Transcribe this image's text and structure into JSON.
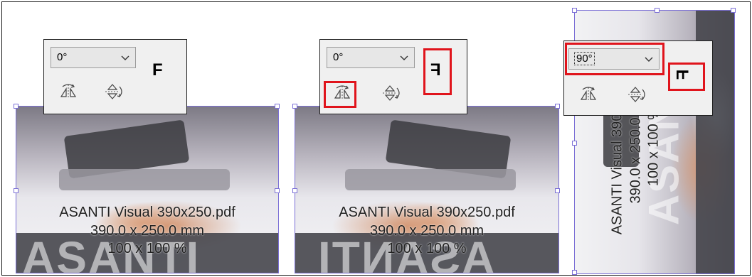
{
  "panels": [
    {
      "rotation": "0°",
      "preview_letter": "F"
    },
    {
      "rotation": "0°",
      "preview_letter": "F"
    },
    {
      "rotation": "90°",
      "preview_letter": "F"
    }
  ],
  "image": {
    "filename": "ASANTI Visual 390x250.pdf",
    "dimensions": "390.0 x 250.0 mm",
    "scale": "100 x 100 %",
    "watermark": "ASANTI"
  },
  "colors": {
    "frame_border": "#7b6fd6",
    "highlight": "#e0141c"
  }
}
